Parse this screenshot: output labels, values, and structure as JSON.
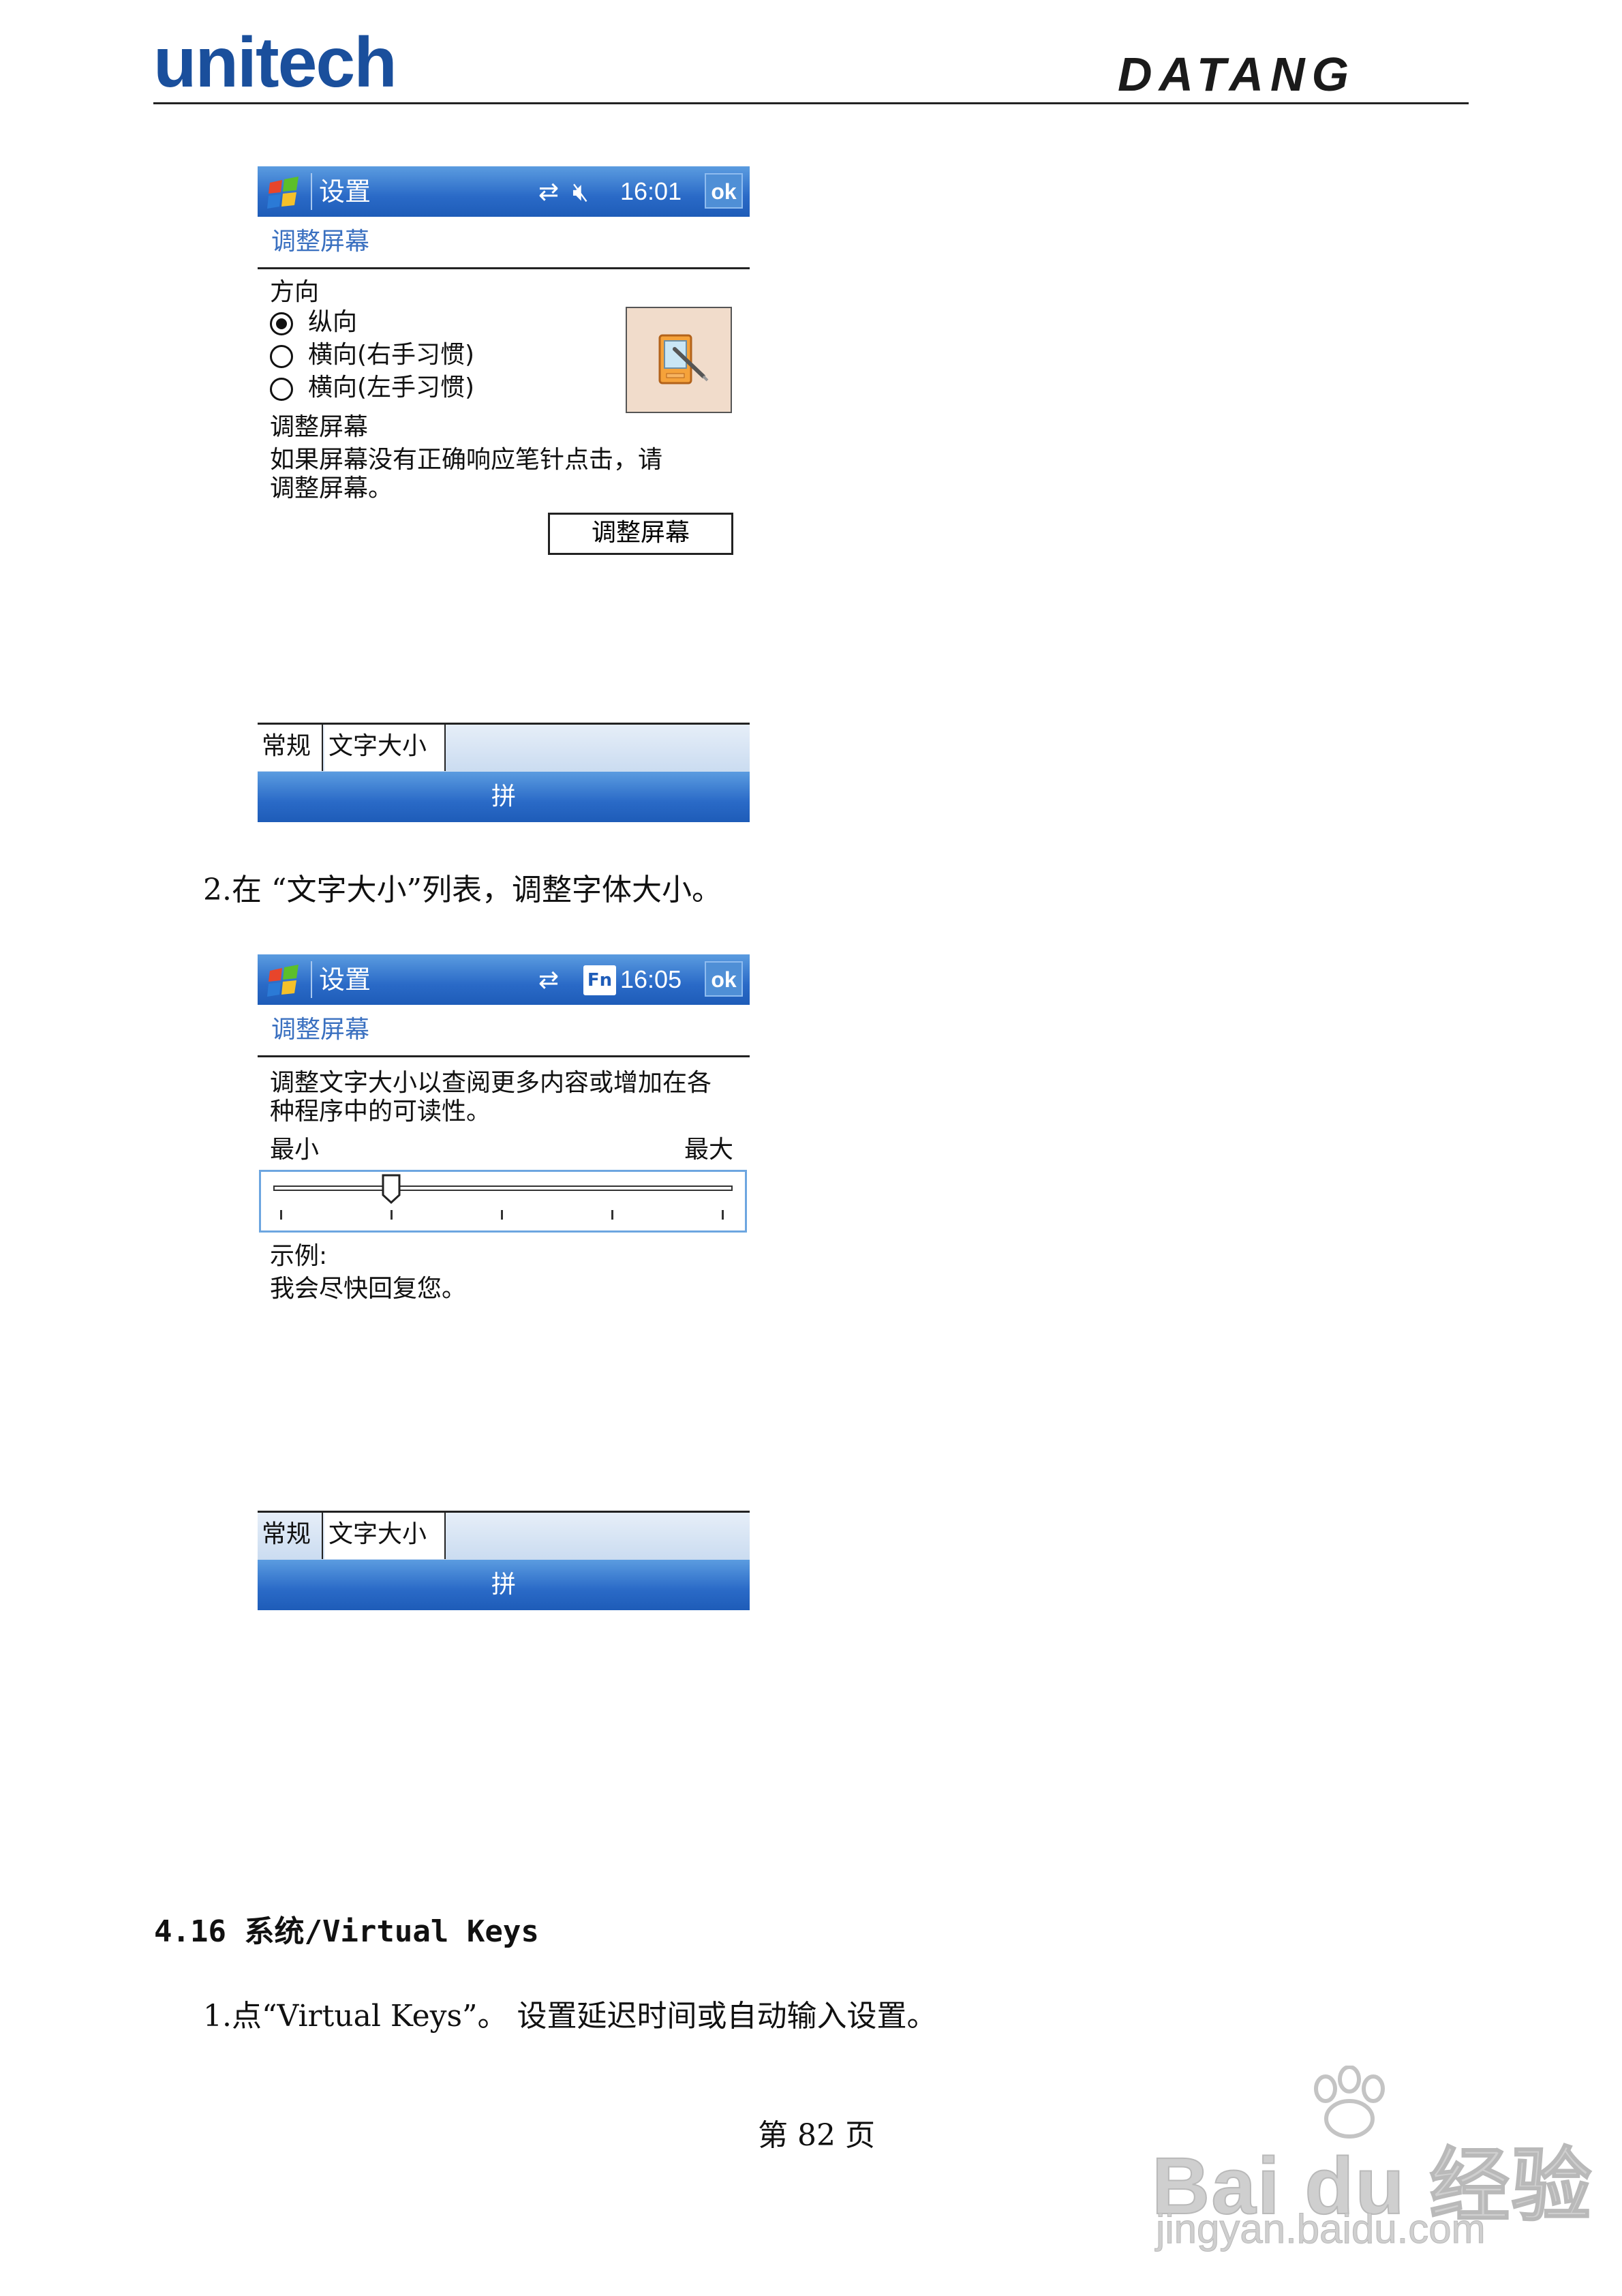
{
  "header": {
    "left_logo": "unitech",
    "right_logo": "DATANG"
  },
  "screen1": {
    "title": "设置",
    "time": "16:01",
    "ok": "ok",
    "subtitle": "调整屏幕",
    "orientation_label": "方向",
    "radios": [
      "纵向",
      "横向(右手习惯)",
      "横向(左手习惯)"
    ],
    "align_label": "调整屏幕",
    "align_desc_1": "如果屏幕没有正确响应笔针点击，请",
    "align_desc_2": "调整屏幕。",
    "align_button": "调整屏幕",
    "tabs": [
      "常规",
      "文字大小"
    ],
    "input_method": "拼"
  },
  "step2": "2.在 “文字大小”列表，调整字体大小。",
  "screen2": {
    "title": "设置",
    "time": "16:05",
    "ok": "ok",
    "fn": "Fn",
    "subtitle": "调整屏幕",
    "desc_1": "调整文字大小以查阅更多内容或增加在各",
    "desc_2": "种程序中的可读性。",
    "min_label": "最小",
    "max_label": "最大",
    "slider_level": 2,
    "slider_steps": 5,
    "sample_label": "示例:",
    "sample_text": "我会尽快回复您。",
    "tabs": [
      "常规",
      "文字大小"
    ],
    "input_method": "拼"
  },
  "section_heading": "4.16 系统/Virtual Keys",
  "step1": "1.点“Virtual Keys”。 设置延迟时间或自动输入设置。",
  "page_number": "第 82 页",
  "watermark": {
    "brand": "Bai du 经验",
    "url": "jingyan.baidu.com"
  }
}
